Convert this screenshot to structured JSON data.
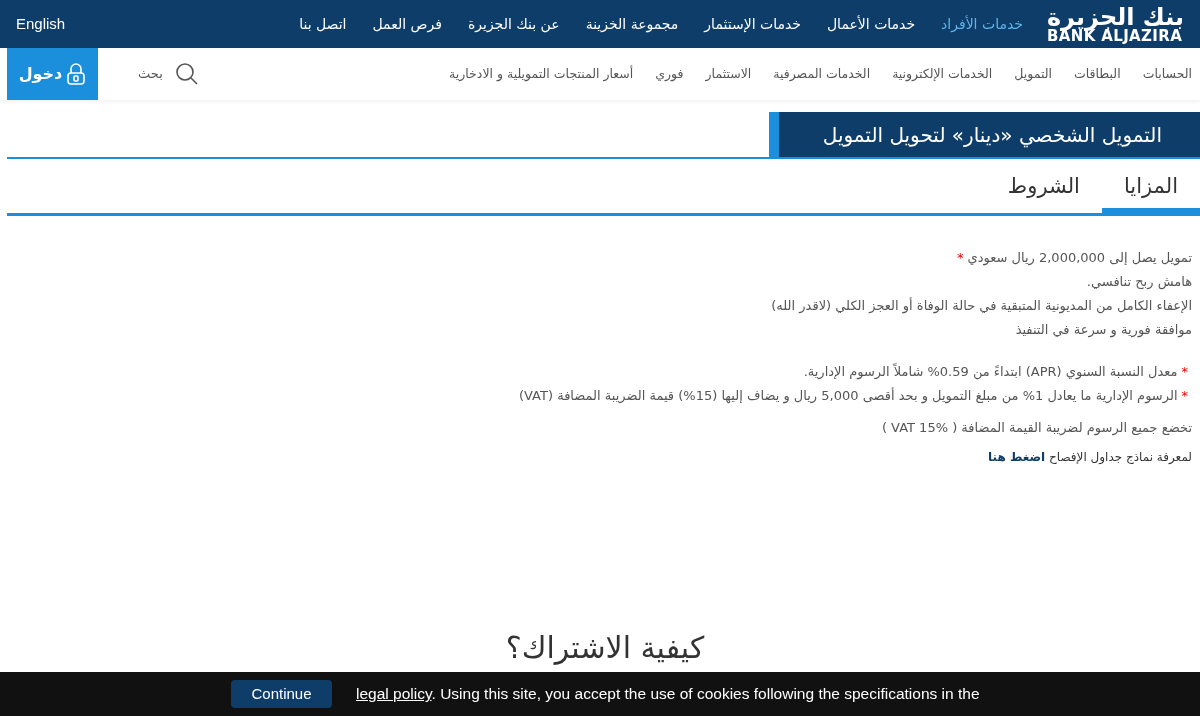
{
  "top_nav": {
    "logo": {
      "arabic": "بنك الجزيرة",
      "latin": "BANK ALJAZIRA"
    },
    "items": [
      {
        "label": "خدمات الأفراد",
        "selected": true
      },
      {
        "label": "خدمات الأعمال",
        "selected": false
      },
      {
        "label": "خدمات الإستثمار",
        "selected": false
      },
      {
        "label": "مجموعة الخزينة",
        "selected": false
      },
      {
        "label": "عن بنك الجزيرة",
        "selected": false
      },
      {
        "label": "فرص العمل",
        "selected": false
      },
      {
        "label": "اتصل بنا",
        "selected": false
      }
    ],
    "language": "English"
  },
  "main_nav": {
    "items": [
      "الحسابات",
      "البطاقات",
      "التمويل",
      "الخدمات الإلكترونية",
      "الخدمات المصرفية",
      "الاستثمار",
      "فوري",
      "أسعار المنتجات التمويلية و الادخارية"
    ],
    "search_label": "بحث",
    "login": "دخول"
  },
  "page_title": "التمويل الشخصي «دينار» لتحويل التمويل",
  "tabs": [
    {
      "label": "المزايا",
      "selected": true
    },
    {
      "label": "الشروط",
      "selected": false
    }
  ],
  "content": [
    [
      {
        "text": "تمويل يصل إلى 2,000,000 ريال سعودي",
        "marker_after": "*"
      },
      {
        "text": "هامش ربح تنافسي."
      },
      {
        "text": "الإعفاء الكامل من المديونية المتبقية في حالة الوفاة أو العجز الكلي (لاقدر الله)"
      },
      {
        "text": "موافقة فورية و سرعة في التنفيذ"
      }
    ],
    [
      {
        "text": "معدل النسبة السنوي (APR) ابتداءً من 0.59% شاملاً الرسوم الإدارية.",
        "marker_before": "*"
      },
      {
        "text": "الرسوم الإدارية ما يعادل 1% من مبلغ التمويل و بحد أقصى 5,000 ريال و يضاف إليها (15%) قيمة الضريبة المضافة (VAT)",
        "marker_before": "*"
      }
    ],
    [
      {
        "text": "تخضع جميع الرسوم لضريبة القيمة المضافة ( VAT 15% )"
      }
    ]
  ],
  "disclosure": {
    "text": "لمعرفة نماذج جداول الإفصاح",
    "link": "اضغط هنا"
  },
  "section_heading": "كيفية الاشتراك؟",
  "cookie_bar": {
    "button": "Continue",
    "link": "legal policy",
    "text": ". Using this site, you accept the use of cookies following the specifications in the"
  }
}
